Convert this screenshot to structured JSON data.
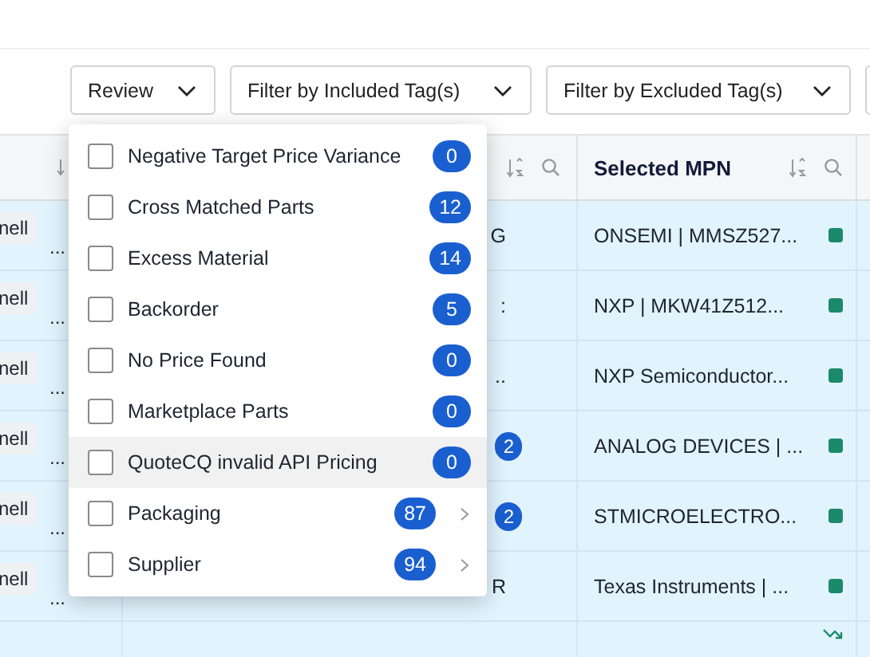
{
  "toolbar": {
    "dropdowns": [
      {
        "label": "Review"
      },
      {
        "label": "Filter by Included Tag(s)"
      },
      {
        "label": "Filter by Excluded Tag(s)"
      }
    ]
  },
  "table": {
    "header_title": "Selected MPN",
    "rows": [
      {
        "chip": "nell",
        "more": "...",
        "column_2": {
          "kind": "clipped",
          "text": "G"
        },
        "mpn": "ONSEMI | MMSZ527...",
        "status": {
          "kind": "square"
        }
      },
      {
        "chip": "nell",
        "more": "...",
        "column_2": {
          "kind": "clipped",
          "text": ":"
        },
        "mpn": "NXP | MKW41Z512...",
        "status": {
          "kind": "square"
        }
      },
      {
        "chip": "nell",
        "more": "...",
        "column_2": {
          "kind": "clipped",
          "text": ".."
        },
        "mpn": "NXP Semiconductor...",
        "status": {
          "kind": "square"
        }
      },
      {
        "chip": "nell",
        "more": "...",
        "column_2": {
          "kind": "badge",
          "text": "2"
        },
        "mpn": "ANALOG DEVICES | ...",
        "status": {
          "kind": "square"
        }
      },
      {
        "chip": "nell",
        "more": "...",
        "column_2": {
          "kind": "badge",
          "text": "2"
        },
        "mpn": "STMICROELECTRO...",
        "status": {
          "kind": "square"
        }
      },
      {
        "chip": "nell",
        "more": "...",
        "column_2": {
          "kind": "clipped",
          "text": "R"
        },
        "mpn": "Texas Instruments | ...",
        "status": {
          "kind": "square"
        }
      },
      {
        "status": {
          "kind": "trend"
        }
      }
    ]
  },
  "menu": {
    "items": [
      {
        "label": "Negative Target Price Variance",
        "count": "0",
        "checked": false,
        "highlighted": false,
        "submenu": false
      },
      {
        "label": "Cross Matched Parts",
        "count": "12",
        "checked": false,
        "highlighted": false,
        "submenu": false
      },
      {
        "label": "Excess Material",
        "count": "14",
        "checked": false,
        "highlighted": false,
        "submenu": false
      },
      {
        "label": "Backorder",
        "count": "5",
        "checked": false,
        "highlighted": false,
        "submenu": false
      },
      {
        "label": "No Price Found",
        "count": "0",
        "checked": false,
        "highlighted": false,
        "submenu": false
      },
      {
        "label": "Marketplace Parts",
        "count": "0",
        "checked": false,
        "highlighted": false,
        "submenu": false
      },
      {
        "label": "QuoteCQ invalid API Pricing",
        "count": "0",
        "checked": false,
        "highlighted": true,
        "submenu": false
      },
      {
        "label": "Packaging",
        "count": "87",
        "checked": false,
        "highlighted": false,
        "submenu": true
      },
      {
        "label": "Supplier",
        "count": "94",
        "checked": false,
        "highlighted": false,
        "submenu": true
      }
    ]
  }
}
